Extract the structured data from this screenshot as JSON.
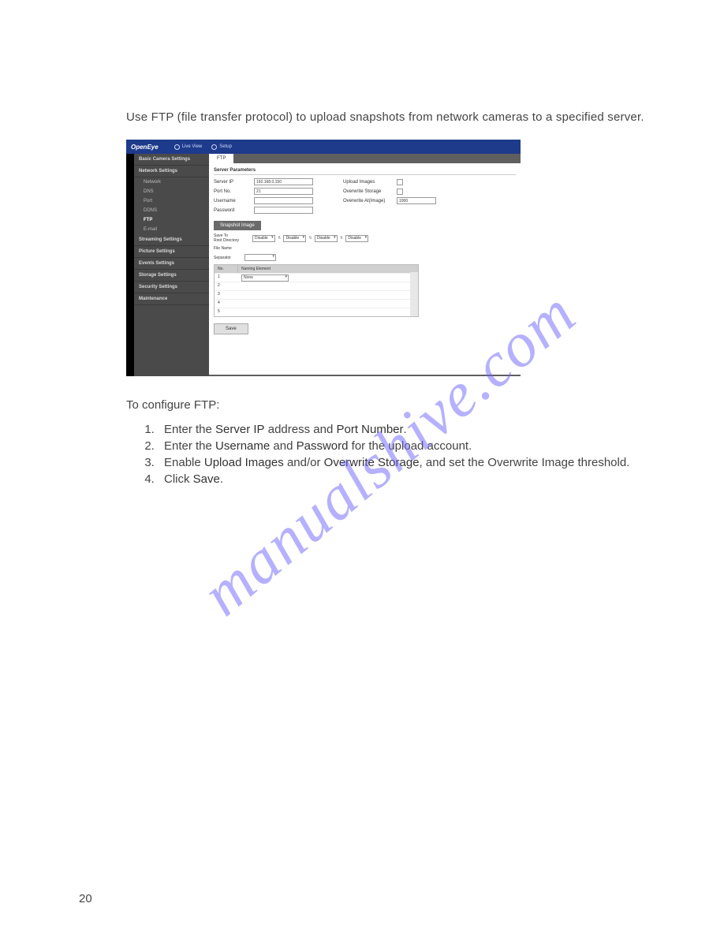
{
  "intro": "Use FTP (file transfer protocol) to upload snapshots from network cameras to a specified server.",
  "screenshot": {
    "brand": "OpenEye",
    "nav": {
      "live_view": "Live View",
      "setup": "Setup"
    },
    "sidebar": {
      "basic": "Basic Camera Settings",
      "network": "Network Settings",
      "subs": {
        "network": "Network",
        "dns": "DNS",
        "port": "Port",
        "ddns": "DDNS",
        "ftp": "FTP",
        "email": "E-mail"
      },
      "streaming": "Streaming Settings",
      "picture": "Picture Settings",
      "events": "Events Settings",
      "storage": "Storage Settings",
      "security": "Security Settings",
      "maintenance": "Maintenance"
    },
    "tab": "FTP",
    "section1": "Server Parameters",
    "fields": {
      "server_ip": "Server IP",
      "server_ip_val": "192.168.0.150",
      "port_no": "Port No.",
      "port_no_val": "21",
      "username": "Username",
      "password": "Password",
      "upload_images": "Upload Images",
      "overwrite_storage": "Overwrite Storage",
      "overwrite_at": "Overwrite At(Image)",
      "overwrite_at_val": "1000"
    },
    "subtab": "Snapshot Image",
    "save_to": "Save To",
    "root_dir": "Root Directory",
    "sep": "\\\\",
    "disable": "Disable",
    "file_name": "File Name",
    "separator": "Separator",
    "table": {
      "no": "No.",
      "naming_element": "Naming Element",
      "none": "None",
      "rows": [
        "1",
        "2",
        "3",
        "4",
        "5"
      ]
    },
    "save_btn": "Save"
  },
  "configure": "To configure FTP:",
  "steps": {
    "s1a": "Enter the ",
    "s1b": "Server IP",
    "s1c": " address and ",
    "s1d": "Port Number",
    "s1e": ".",
    "s2a": "Enter the ",
    "s2b": "Username",
    "s2c": " and ",
    "s2d": "Password",
    "s2e": " for the upload account.",
    "s3a": "Enable ",
    "s3b": "Upload Images",
    "s3c": " and/or ",
    "s3d": "Overwrite Storage",
    "s3e": ", and set the Overwrite Image threshold.",
    "s4a": "Click ",
    "s4b": "Save",
    "s4c": "."
  },
  "watermark": "manualshive.com",
  "page_number": "20"
}
